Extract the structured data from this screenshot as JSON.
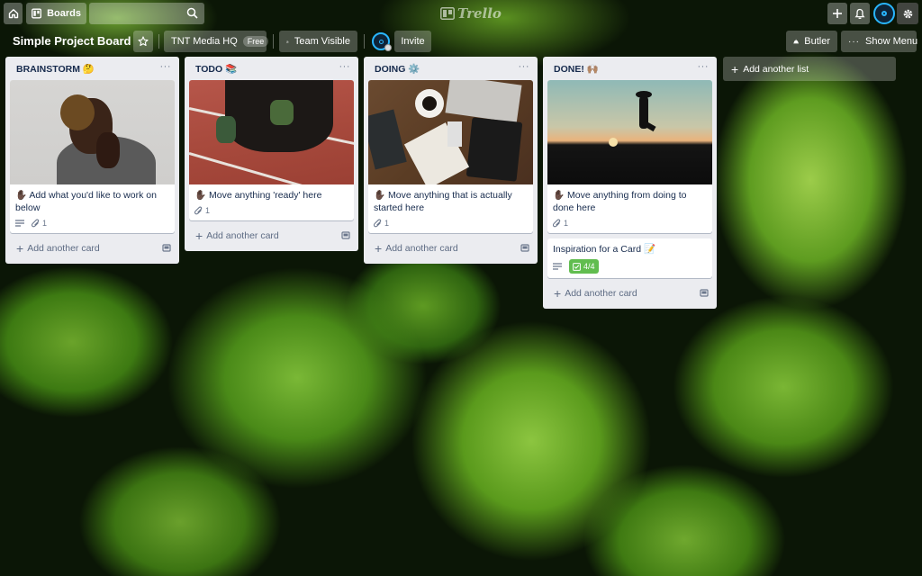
{
  "topbar": {
    "boards_label": "Boards",
    "search_placeholder": "",
    "logo_text": "Trello"
  },
  "board": {
    "title": "Simple Project Board",
    "team_name": "TNT Media HQ",
    "team_plan": "Free",
    "visibility_label": "Team Visible",
    "invite_label": "Invite",
    "butler_label": "Butler",
    "menu_label": "Show Menu"
  },
  "lists": [
    {
      "title": "BRAINSTORM 🤔",
      "cards": [
        {
          "title": "✋🏿 Add what you'd like to work on below",
          "has_description": true,
          "attachments": "1",
          "cover": "person-thinking"
        }
      ],
      "add_card_label": "Add another card"
    },
    {
      "title": "TODO 📚",
      "cards": [
        {
          "title": "✋🏿 Move anything 'ready' here",
          "has_description": false,
          "attachments": "1",
          "cover": "runner-start"
        }
      ],
      "add_card_label": "Add another card"
    },
    {
      "title": "DOING ⚙️",
      "cards": [
        {
          "title": "✋🏿 Move anything that is actually started here",
          "has_description": false,
          "attachments": "1",
          "cover": "desk-workspace"
        }
      ],
      "add_card_label": "Add another card"
    },
    {
      "title": "DONE! 🙌🏽",
      "cards": [
        {
          "title": "✋🏿 Move anything from doing to done here",
          "has_description": false,
          "attachments": "1",
          "cover": "jump-sunset"
        },
        {
          "title": "Inspiration for a Card 📝",
          "has_description": true,
          "checklist": "4/4"
        }
      ],
      "add_card_label": "Add another card"
    }
  ],
  "add_list_label": "Add another list",
  "colors": {
    "list_bg": "#ebecf0",
    "checklist_complete": "#61bd4f",
    "avatar_ring": "#29b6ff"
  }
}
